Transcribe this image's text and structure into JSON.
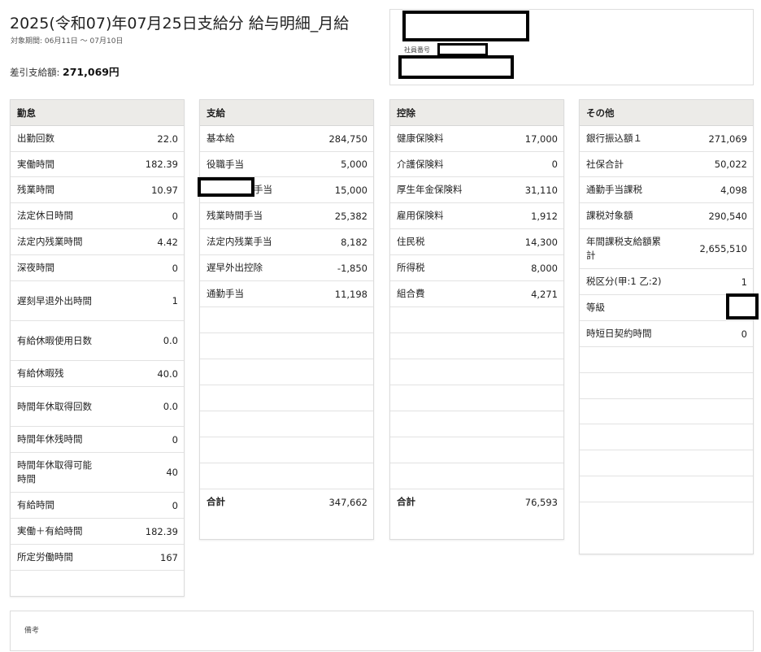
{
  "header": {
    "title": "2025(令和07)年07月25日支給分 給与明細_月給",
    "period": "対象期間: 06月11日 〜 07月10日",
    "net_label": "差引支給額: ",
    "net_amount": "271,069円"
  },
  "employee": {
    "number_label": "社員番号"
  },
  "attendance": {
    "title": "勤怠",
    "rows": [
      {
        "label": "出勤回数",
        "value": "22.0"
      },
      {
        "label": "実働時間",
        "value": "182.39"
      },
      {
        "label": "残業時間",
        "value": "10.97"
      },
      {
        "label": "法定休日時間",
        "value": "0"
      },
      {
        "label": "法定内残業時間",
        "value": "4.42"
      },
      {
        "label": "深夜時間",
        "value": "0"
      },
      {
        "label": "遅刻早退外出時間",
        "value": "1"
      },
      {
        "label": "有給休暇使用日数",
        "value": "0.0"
      },
      {
        "label": "有給休暇残",
        "value": "40.0"
      },
      {
        "label": "時間年休取得回数",
        "value": "0.0"
      },
      {
        "label": "時間年休残時間",
        "value": "0"
      },
      {
        "label": "時間年休取得可能時間",
        "value": "40"
      },
      {
        "label": "有給時間",
        "value": "0"
      },
      {
        "label": "実働＋有給時間",
        "value": "182.39"
      },
      {
        "label": "所定労働時間",
        "value": "167"
      }
    ]
  },
  "payments": {
    "title": "支給",
    "rows": [
      {
        "label": "基本給",
        "value": "284,750"
      },
      {
        "label": "役職手当",
        "value": "5,000"
      },
      {
        "label": "手当",
        "value": "15,000"
      },
      {
        "label": "残業時間手当",
        "value": "25,382"
      },
      {
        "label": "法定内残業手当",
        "value": "8,182"
      },
      {
        "label": "遅早外出控除",
        "value": "-1,850"
      },
      {
        "label": "通勤手当",
        "value": "11,198"
      }
    ],
    "total_label": "合計",
    "total_value": "347,662"
  },
  "deductions": {
    "title": "控除",
    "rows": [
      {
        "label": "健康保険料",
        "value": "17,000"
      },
      {
        "label": "介護保険料",
        "value": "0"
      },
      {
        "label": "厚生年金保険料",
        "value": "31,110"
      },
      {
        "label": "雇用保険料",
        "value": "1,912"
      },
      {
        "label": "住民税",
        "value": "14,300"
      },
      {
        "label": "所得税",
        "value": "8,000"
      },
      {
        "label": "組合費",
        "value": "4,271"
      }
    ],
    "total_label": "合計",
    "total_value": "76,593"
  },
  "other": {
    "title": "その他",
    "rows": [
      {
        "label": "銀行振込額１",
        "value": "271,069"
      },
      {
        "label": "社保合計",
        "value": "50,022"
      },
      {
        "label": "通勤手当課税",
        "value": "4,098"
      },
      {
        "label": "課税対象額",
        "value": "290,540"
      },
      {
        "label": "年間課税支給額累計",
        "value": "2,655,510"
      },
      {
        "label": "税区分(甲:1 乙:2)",
        "value": "1"
      },
      {
        "label": "等級",
        "value": ""
      },
      {
        "label": "時短日契約時間",
        "value": "0"
      }
    ]
  },
  "remarks": {
    "label": "備考"
  }
}
